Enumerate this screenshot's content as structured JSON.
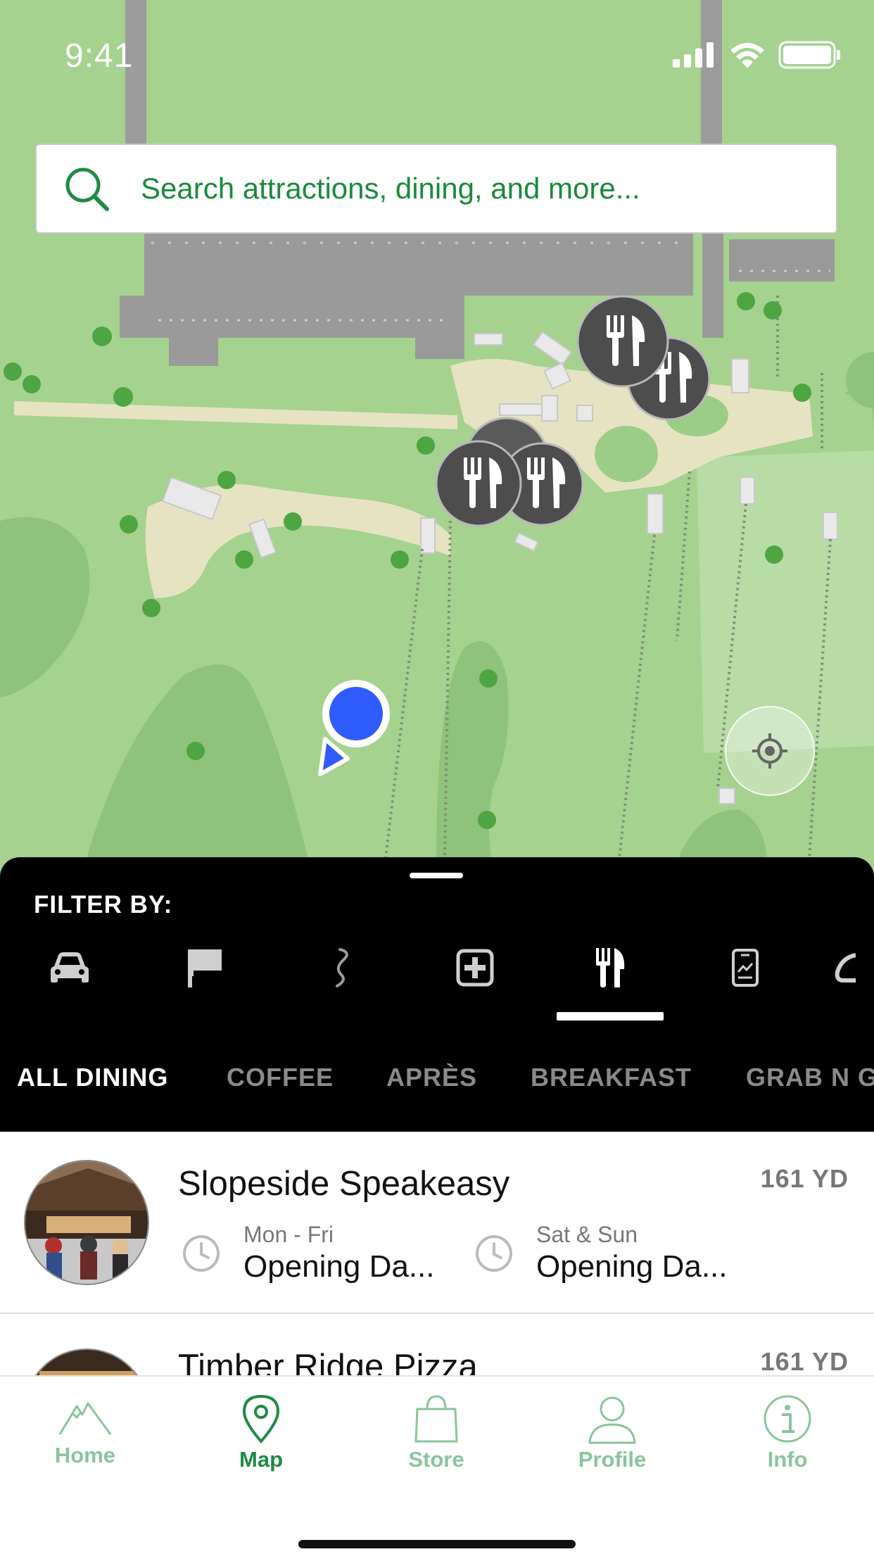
{
  "status_bar": {
    "time": "9:41"
  },
  "search": {
    "placeholder": "Search attractions, dining, and more..."
  },
  "filter": {
    "label": "FILTER BY:",
    "icons": [
      "car-icon",
      "flag-icon",
      "trail-icon",
      "first-aid-icon",
      "dining-icon",
      "phone-app-icon",
      "more-icon"
    ],
    "active": "dining-icon"
  },
  "subtabs": [
    "ALL DINING",
    "COFFEE",
    "APRÈS",
    "BREAKFAST",
    "GRAB N G"
  ],
  "list": [
    {
      "name": "Slopeside Speakeasy",
      "distance": "161 YD",
      "hours": [
        {
          "days": "Mon - Fri",
          "value": "Opening Da..."
        },
        {
          "days": "Sat & Sun",
          "value": "Opening Da..."
        }
      ]
    },
    {
      "name": "Timber Ridge Pizza",
      "distance": "161 YD"
    }
  ],
  "tabs": [
    {
      "label": "Home",
      "icon": "mountain-icon"
    },
    {
      "label": "Map",
      "icon": "map-pin-icon",
      "active": true
    },
    {
      "label": "Store",
      "icon": "bag-icon"
    },
    {
      "label": "Profile",
      "icon": "person-icon"
    },
    {
      "label": "Info",
      "icon": "info-icon"
    }
  ],
  "colors": {
    "accent": "#1f8a44",
    "accent_light": "#88c69a",
    "map_grass": "#a5d28f",
    "user_dot": "#2f5bff"
  }
}
